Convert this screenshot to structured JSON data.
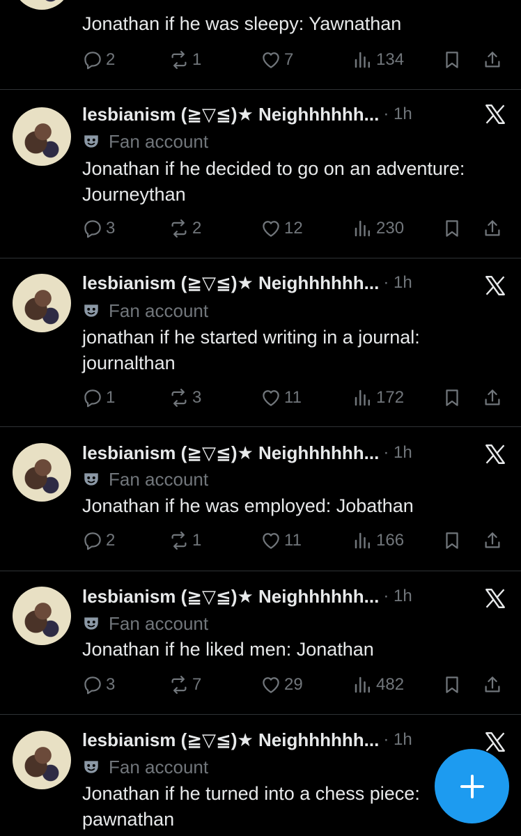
{
  "tweets": [
    {
      "name": "",
      "time": "",
      "label": "Fan account",
      "text": "Jonathan if he was sleepy: Yawnathan",
      "replies": "2",
      "reposts": "1",
      "likes": "7",
      "views": "134"
    },
    {
      "name": "lesbianism (≧▽≦)★ Neighhhhhh...",
      "time": "· 1h",
      "label": "Fan account",
      "text": "Jonathan if he decided to go on an adventure: Journeythan",
      "replies": "3",
      "reposts": "2",
      "likes": "12",
      "views": "230"
    },
    {
      "name": "lesbianism (≧▽≦)★ Neighhhhhh...",
      "time": "· 1h",
      "label": "Fan account",
      "text": "jonathan if he started writing in a journal: journalthan",
      "replies": "1",
      "reposts": "3",
      "likes": "11",
      "views": "172"
    },
    {
      "name": "lesbianism (≧▽≦)★ Neighhhhhh...",
      "time": "· 1h",
      "label": "Fan account",
      "text": "Jonathan if he was employed: Jobathan",
      "replies": "2",
      "reposts": "1",
      "likes": "11",
      "views": "166"
    },
    {
      "name": "lesbianism (≧▽≦)★ Neighhhhhh...",
      "time": "· 1h",
      "label": "Fan account",
      "text": "Jonathan if he liked men: Jonathan",
      "replies": "3",
      "reposts": "7",
      "likes": "29",
      "views": "482"
    },
    {
      "name": "lesbianism (≧▽≦)★ Neighhhhhh...",
      "time": "· 1h",
      "label": "Fan account",
      "text": "Jonathan if he turned into a chess piece: pawnathan",
      "replies": "",
      "reposts": "",
      "likes": "",
      "views": ""
    }
  ],
  "icons": {
    "reply": "reply-icon",
    "repost": "repost-icon",
    "like": "heart-icon",
    "views": "views-icon",
    "bookmark": "bookmark-icon",
    "share": "share-icon",
    "x_logo": "x-logo-icon",
    "fan_label": "mask-icon",
    "compose": "plus-icon"
  },
  "colors": {
    "background": "#000000",
    "text": "#e7e9ea",
    "muted": "#71767b",
    "accent": "#1d9bf0",
    "divider": "#2f3336"
  }
}
